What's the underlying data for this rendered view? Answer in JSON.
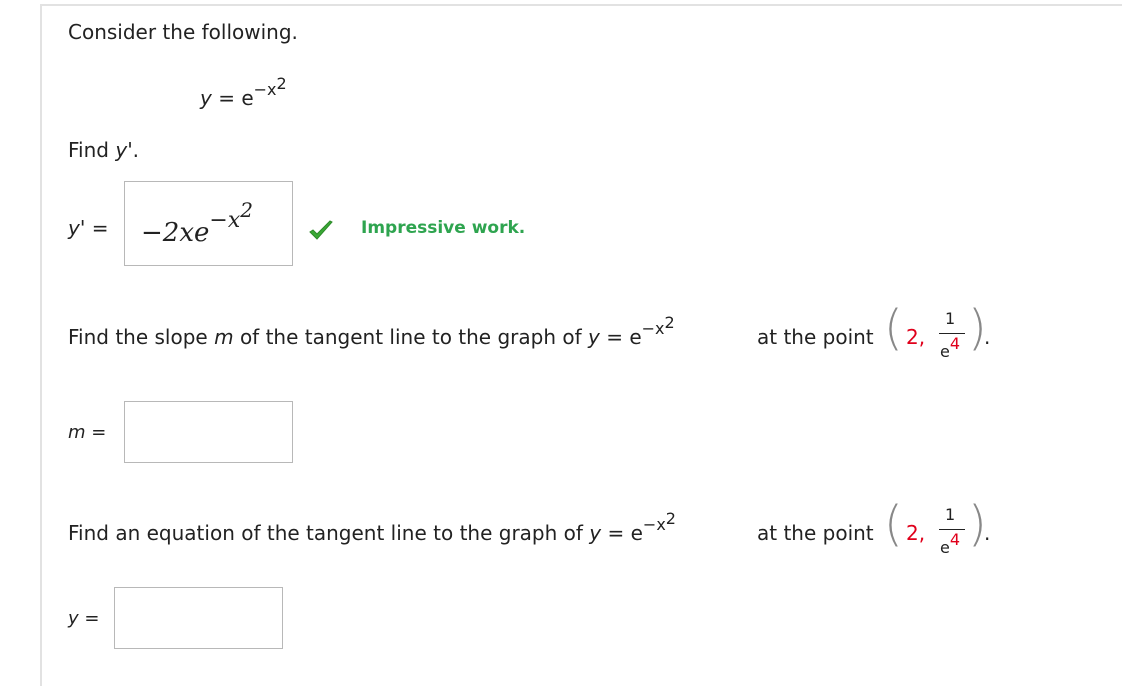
{
  "heading": "Consider the following.",
  "function": {
    "lhs": "y",
    "eq": "=",
    "base": "e",
    "exponent": "−x",
    "exp_power": "2"
  },
  "part1": {
    "prompt_prefix": "Find",
    "prompt_var": "y",
    "prompt_suffix": "'.",
    "answer_label_var": "y",
    "answer_label_suffix": "' =",
    "answer": {
      "coef": "−2xe",
      "exponent": "−x",
      "exp_power": "2"
    },
    "feedback": "Impressive work."
  },
  "part2": {
    "prompt_prefix": "Find the slope",
    "prompt_var": "m",
    "prompt_mid": "of the tangent line to the graph of",
    "prompt_y": "y",
    "prompt_eq": "= e",
    "exponent": "−x",
    "exp_power": "2",
    "at_the_point": "at the point",
    "point_x": "2,",
    "point_num": "1",
    "point_den": "e",
    "point_den_power": "4",
    "period": ".",
    "answer_label_var": "m",
    "answer_label_eq": "=",
    "answer_value": ""
  },
  "part3": {
    "prompt_prefix": "Find an equation of the tangent line to the graph of",
    "prompt_y": "y",
    "prompt_eq": "= e",
    "exponent": "−x",
    "exp_power": "2",
    "at_the_point": "at the point",
    "point_x": "2,",
    "point_num": "1",
    "point_den": "e",
    "point_den_power": "4",
    "period": ".",
    "answer_label_var": "y",
    "answer_label_eq": "=",
    "answer_value": ""
  },
  "colors": {
    "correct": "#2ea44f",
    "highlight": "#e0001b"
  },
  "icons": {
    "correct_mark": "check-icon"
  }
}
